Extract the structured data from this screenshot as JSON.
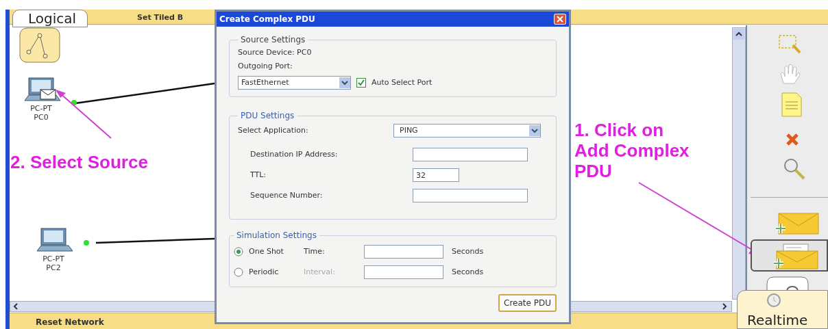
{
  "top_bar": {
    "view_tab": "Logical",
    "button": "Set Tiled B"
  },
  "devices": [
    {
      "model": "PC-PT",
      "name": "PC0",
      "sending": true
    },
    {
      "model": "PC-PT",
      "name": "PC2",
      "sending": false
    }
  ],
  "annotations": [
    {
      "lines": [
        "2. Select Source"
      ]
    },
    {
      "lines": [
        "1. Click on",
        "Add Complex",
        "PDU"
      ]
    }
  ],
  "dialog": {
    "title": "Create Complex PDU",
    "source_settings": {
      "legend": "Source Settings",
      "source_device": "Source Device: PC0",
      "port_label": "Outgoing Port:",
      "port": "FastEthernet",
      "auto_select": {
        "label": "Auto Select Port",
        "checked": true
      }
    },
    "pdu_settings": {
      "legend": "PDU Settings",
      "app_label": "Select Application:",
      "app": "PING",
      "fields": [
        {
          "label": "Destination IP Address:",
          "kind": "long"
        },
        {
          "label": "TTL:",
          "value": "32",
          "kind": "short"
        },
        {
          "label": "Sequence Number:",
          "kind": "long"
        }
      ]
    },
    "simulation_settings": {
      "legend": "Simulation Settings",
      "options": [
        {
          "label": "One Shot",
          "selected": true,
          "field_label": "Time:",
          "unit": "Seconds",
          "disabled": false
        },
        {
          "label": "Periodic",
          "selected": false,
          "field_label": "Interval:",
          "unit": "Seconds",
          "disabled": true
        }
      ]
    },
    "button": "Create PDU"
  },
  "status_bar": {
    "reset": "Reset Network",
    "mode": "Realtime"
  }
}
